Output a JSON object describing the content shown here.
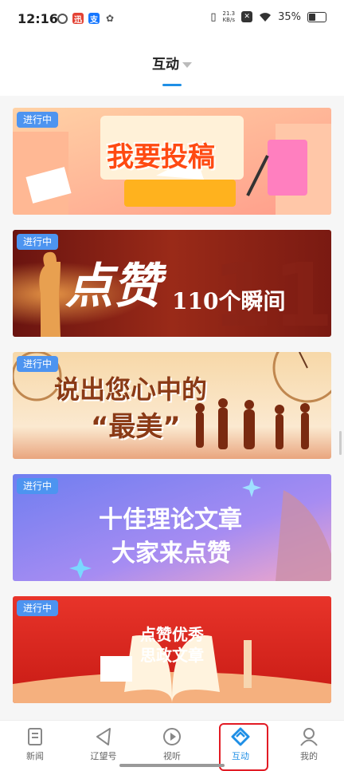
{
  "status_bar": {
    "time": "12:16",
    "net_speed_value": "21.3",
    "net_speed_unit": "KB/s",
    "battery": "35%",
    "battery_level": 0.35
  },
  "header": {
    "title": "互动"
  },
  "banners": [
    {
      "badge": "进行中",
      "title": "我要投稿",
      "colors": {
        "bg": "#ffb48a",
        "accent": "#ff5a1f"
      }
    },
    {
      "badge": "进行中",
      "title_main": "点赞",
      "title_sub": "110个瞬间",
      "colors": {
        "bg": "#8a1c14",
        "accent": "#e8b070"
      }
    },
    {
      "badge": "进行中",
      "title_line1": "说出您心中的",
      "title_line2": "“最美”",
      "colors": {
        "bg": "#f5e1c4",
        "accent": "#a0441e"
      }
    },
    {
      "badge": "进行中",
      "title_line1": "十佳理论文章",
      "title_line2": "大家来点赞",
      "colors": {
        "bg": "#7a88f0",
        "accent": "#ffffff"
      }
    },
    {
      "badge": "进行中",
      "title_line1": "点赞优秀",
      "title_line2": "思政文章",
      "colors": {
        "bg": "#e02d22",
        "accent": "#ffffff"
      }
    }
  ],
  "tabs": [
    {
      "label": "新闻",
      "icon": "news-icon"
    },
    {
      "label": "辽望号",
      "icon": "send-icon"
    },
    {
      "label": "视听",
      "icon": "play-icon"
    },
    {
      "label": "互动",
      "icon": "interact-icon",
      "active": true
    },
    {
      "label": "我的",
      "icon": "user-icon"
    }
  ],
  "colors": {
    "accent": "#1f8fe6",
    "badge": "#4d94f0",
    "highlight": "#e21b24"
  }
}
